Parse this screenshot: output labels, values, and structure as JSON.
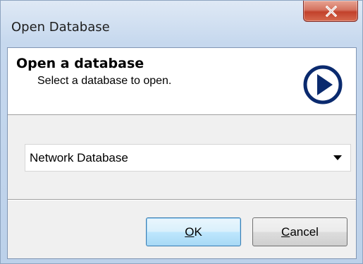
{
  "window": {
    "title": "Open Database"
  },
  "header": {
    "heading": "Open a database",
    "subheading": "Select a database to open.",
    "icon": "play-circle-icon",
    "icon_color": "#0a2a6e"
  },
  "database_select": {
    "selected": "Network Database"
  },
  "buttons": {
    "ok_mnemonic": "O",
    "ok_rest": "K",
    "cancel_mnemonic": "C",
    "cancel_rest": "ancel"
  },
  "colors": {
    "close_button": "#c2412b",
    "default_button_border": "#3c7fb1"
  }
}
